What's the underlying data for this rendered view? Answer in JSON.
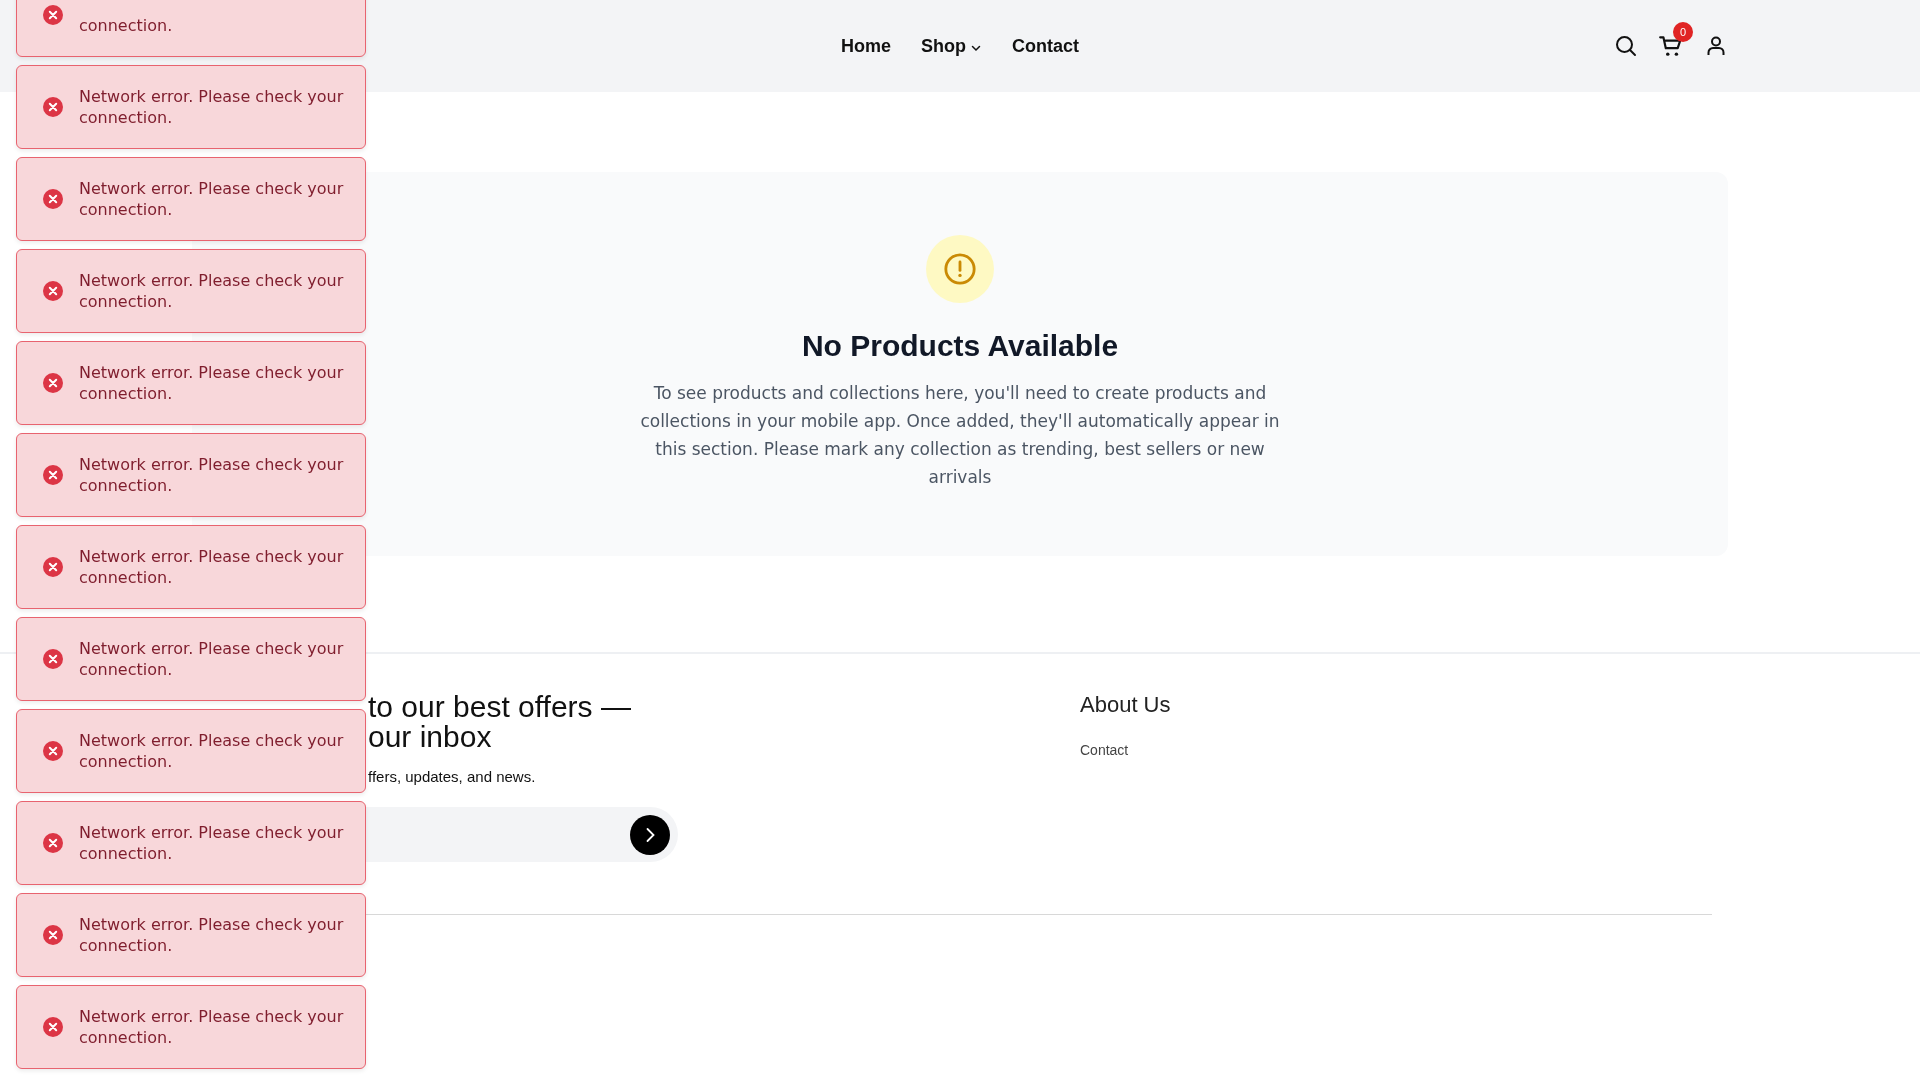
{
  "header": {
    "nav": [
      {
        "label": "Home",
        "kind": "link"
      },
      {
        "label": "Shop",
        "kind": "dropdown"
      },
      {
        "label": "Contact",
        "kind": "link"
      }
    ],
    "cart_count": "0"
  },
  "empty_state": {
    "title": "No Products Available",
    "message": "To see products and collections here, you'll need to create products and collections in your mobile app. Once added, they'll automatically appear in this section. Please mark any collection as trending, best sellers or new arrivals"
  },
  "footer": {
    "newsletter": {
      "heading_lines": [
        "to our best offers —",
        "our inbox"
      ],
      "subtitle": "ffers, updates, and news."
    },
    "columns": [
      {
        "title": "About Us",
        "links": [
          "Contact"
        ]
      }
    ]
  },
  "toasts": [
    {
      "kind": "error",
      "message": "connection."
    },
    {
      "kind": "error",
      "message": "Network error. Please check your connection."
    },
    {
      "kind": "error",
      "message": "Network error. Please check your connection."
    },
    {
      "kind": "error",
      "message": "Network error. Please check your connection."
    },
    {
      "kind": "error",
      "message": "Network error. Please check your connection."
    },
    {
      "kind": "error",
      "message": "Network error. Please check your connection."
    },
    {
      "kind": "error",
      "message": "Network error. Please check your connection."
    },
    {
      "kind": "error",
      "message": "Network error. Please check your connection."
    },
    {
      "kind": "error",
      "message": "Network error. Please check your connection."
    },
    {
      "kind": "error",
      "message": "Network error. Please check your connection."
    },
    {
      "kind": "error",
      "message": "Network error. Please check your connection."
    },
    {
      "kind": "error",
      "message": "Network error. Please check your connection."
    }
  ]
}
